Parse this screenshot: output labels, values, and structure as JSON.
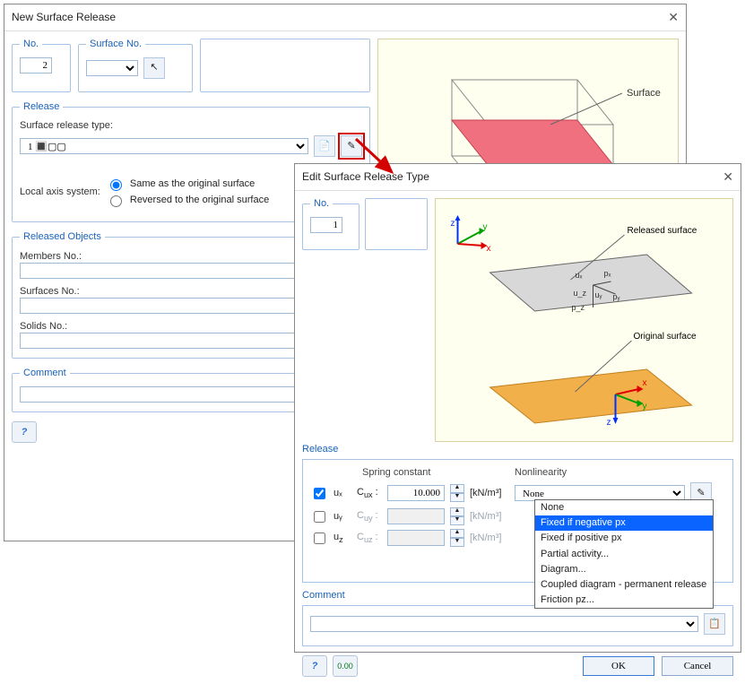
{
  "dlg1": {
    "title": "New Surface Release",
    "no_group": "No.",
    "no_value": "2",
    "surfno_group": "Surface No.",
    "release_group": "Release",
    "rel_type_label": "Surface release type:",
    "rel_type_value": "1    🔳▢▢",
    "local_axis_label": "Local axis system:",
    "axis_same": "Same as the original surface",
    "axis_rev": "Reversed to the original surface",
    "rel_obj_group": "Released Objects",
    "members_label": "Members No.:",
    "surfaces_label": "Surfaces No.:",
    "solids_label": "Solids No.:",
    "comment_group": "Comment",
    "preview_surface_label": "Surface"
  },
  "dlg2": {
    "title": "Edit Surface Release Type",
    "no_group": "No.",
    "no_value": "1",
    "released_surface_label": "Released surface",
    "original_surface_label": "Original surface",
    "release_group": "Release",
    "spring_header": "Spring constant",
    "nonlin_header": "Nonlinearity",
    "ux_label": "uₓ",
    "uy_label": "uᵧ",
    "uz_label": "u_z",
    "cux_label": "Cᵤₓ",
    "cuy_label": "Cᵤᵧ",
    "cuz_label": "Cᵤ_z",
    "cux_val": "10.000",
    "unit": "[kN/m³]",
    "nonlin_sel": "None",
    "nonlin_opts": [
      "None",
      "Fixed if negative px",
      "Fixed if positive px",
      "Partial activity...",
      "Diagram...",
      "Coupled diagram - permanent release",
      "Friction pz..."
    ],
    "comment_group": "Comment",
    "ok": "OK",
    "cancel": "Cancel"
  },
  "axes": {
    "x": "x",
    "y": "y",
    "z": "z",
    "px": "pₓ",
    "py": "pᵧ",
    "pz": "p_z"
  }
}
